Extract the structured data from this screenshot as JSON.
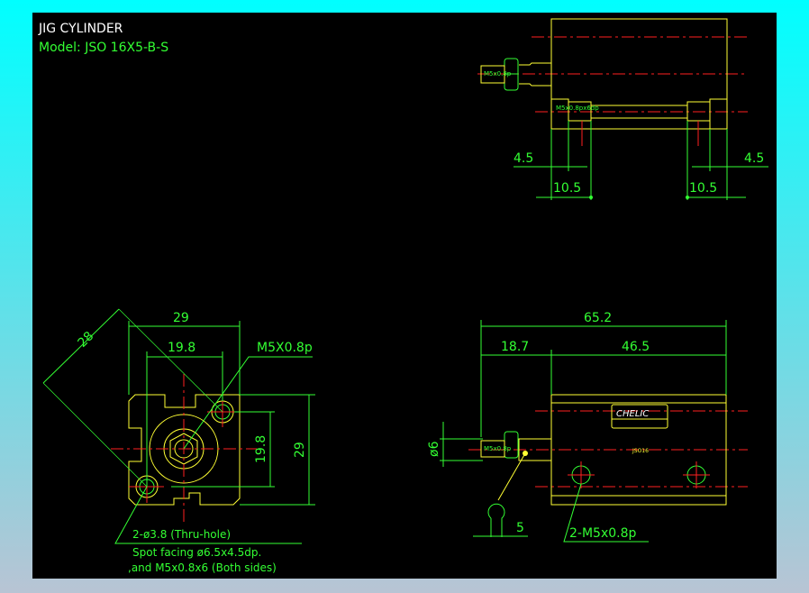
{
  "title": "JIG CYLINDER",
  "model": "Model:  JSO 16X5-B-S",
  "colors": {
    "background": "#000000",
    "outline": "#ffff33",
    "dimension": "#33ff33",
    "centerline": "#ff2020",
    "frame_top": "#00ffff"
  },
  "top_view": {
    "port_label": "M5x0.8p",
    "bore_label": "M5x0.8px6dp",
    "dim_left_small": "4.5",
    "dim_left_large": "10.5",
    "dim_right_small": "4.5",
    "dim_right_large": "10.5"
  },
  "end_view": {
    "dim_width": "29",
    "dim_hole_pitch_h": "19.8",
    "dim_diagonal": "28",
    "dim_hole_pitch_v": "19.8",
    "dim_height": "29",
    "port_label": "M5X0.8p",
    "note_line1": "2-ø3.8 (Thru-hole)",
    "note_line2": "Spot facing  ø6.5x4.5dp.",
    "note_line3": ",and M5x0.8x6 (Both sides)"
  },
  "side_view": {
    "dim_total": "65.2",
    "dim_rod": "18.7",
    "dim_body": "46.5",
    "dim_rod_dia": "ø6",
    "dim_sensor": "5",
    "hole_label": "2-M5x0.8p",
    "port_label": "M5x0.8p",
    "brand": "CHELIC",
    "nameplate_model": "JSO16"
  }
}
